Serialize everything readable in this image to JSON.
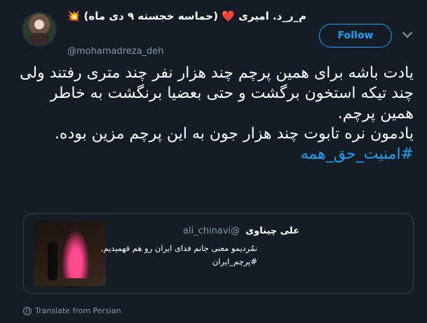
{
  "author": {
    "name_part1": "م_ر_د. امیری",
    "heart_glyph": "❤️",
    "name_part2": "(حماسه خجسته ۹ دی ماه)",
    "burst_glyph": "💥",
    "handle": "@mohamadreza_deh"
  },
  "follow_button": {
    "label": "Follow"
  },
  "tweet": {
    "lines": [
      "یادت باشه برای همین پرچم چند هزار نفر چند متری رفتند ولی چند تیکه استخون برگشت و حتی بعضیا برنگشت به خاطر همین پرچم.",
      "یادمون نره تابوت چند هزار جون به این پرچم مزین بوده."
    ],
    "hashtag": "#امنیت_حق_همه"
  },
  "quoted_tweet": {
    "name": "علی چیناوی",
    "handle": "@ali_chinavi",
    "text": "نمُردیمو معنی جانم فدای ایران رو هم فهمیدیم.",
    "hashtag": "#پرچم_ایران"
  },
  "translate": {
    "label": "Translate from Persian"
  },
  "colors": {
    "background": "#141d26",
    "accent": "#1da1f2",
    "secondary_text": "#8899a6",
    "border": "#38444d"
  }
}
